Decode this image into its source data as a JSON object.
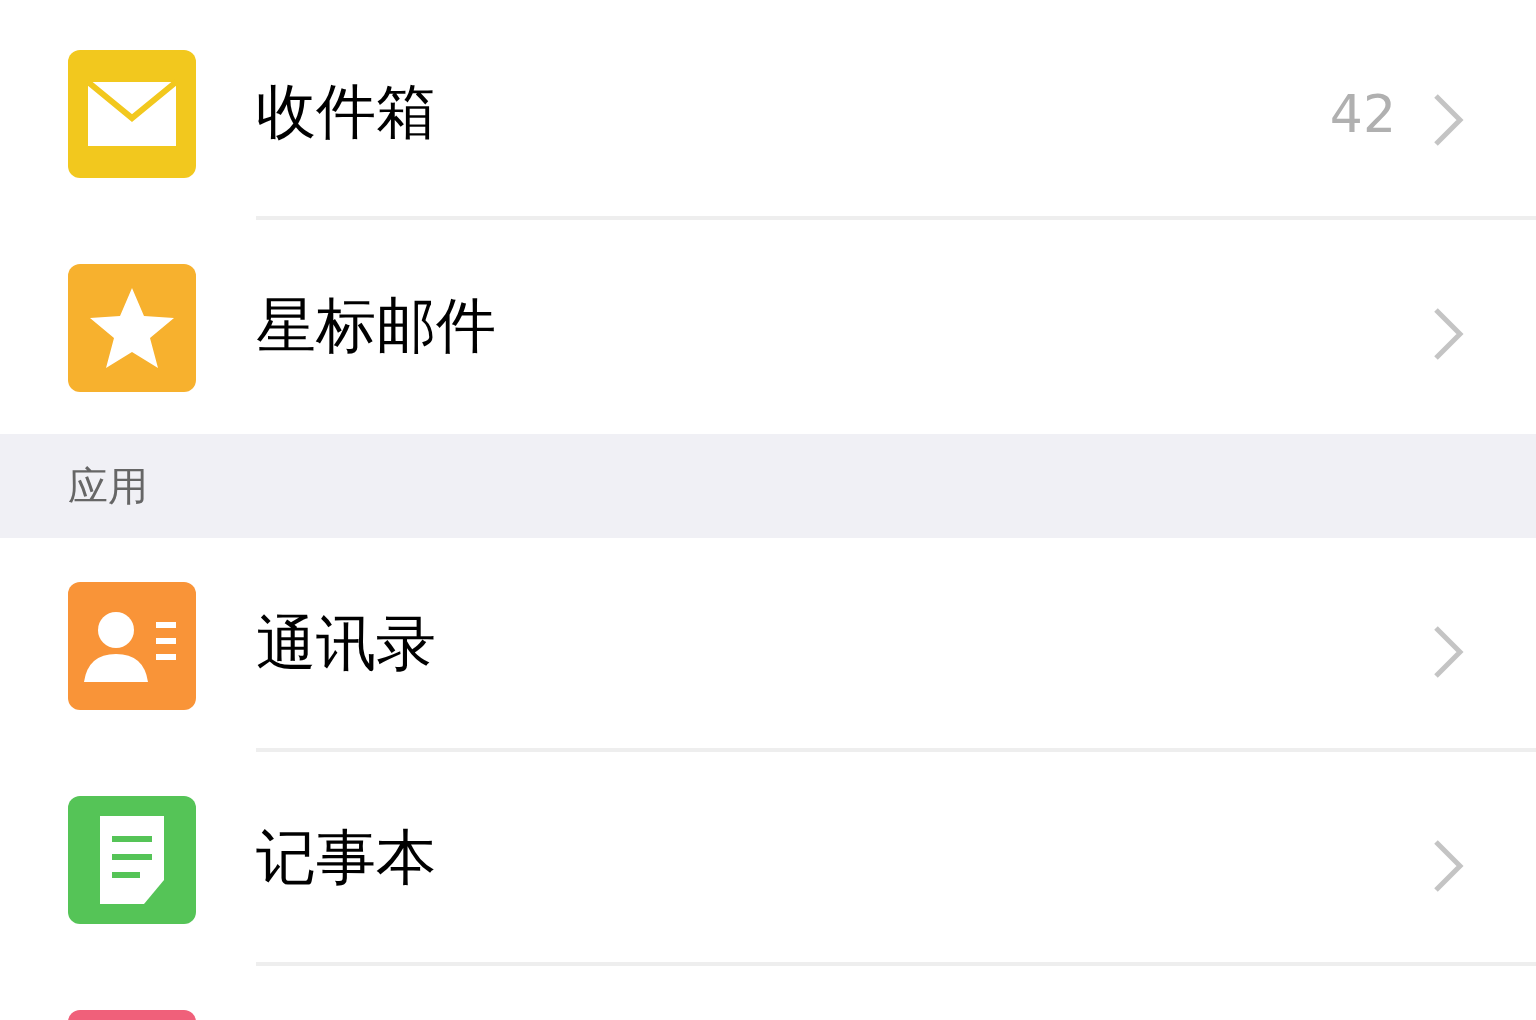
{
  "sections": [
    {
      "items": [
        {
          "kind": "mail",
          "color": "#f2c81e",
          "label": "收件箱",
          "count": "42"
        },
        {
          "kind": "star",
          "color": "#f7b12e",
          "label": "星标邮件"
        }
      ]
    },
    {
      "title": "应用",
      "items": [
        {
          "kind": "contacts",
          "color": "#f99438",
          "label": "通讯录"
        },
        {
          "kind": "notes",
          "color": "#55c457",
          "label": "记事本"
        },
        {
          "kind": "blank",
          "color": "#f0607a"
        }
      ]
    }
  ]
}
